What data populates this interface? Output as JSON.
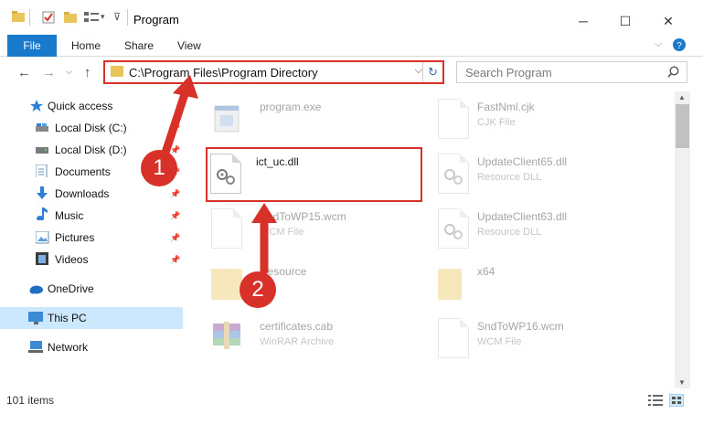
{
  "window": {
    "title": "Program",
    "minimize_glyph": "─",
    "maximize_glyph": "☐",
    "close_glyph": "✕"
  },
  "ribbon": {
    "tabs": [
      "File",
      "Home",
      "Share",
      "View"
    ]
  },
  "address": {
    "path": "C:\\Program Files\\Program Directory",
    "dropdown_glyph": "⌵",
    "refresh_glyph": "↻"
  },
  "search": {
    "placeholder": "Search Program",
    "icon": "search-icon"
  },
  "nav": {
    "items": [
      {
        "label": "Quick access",
        "icon": "star-icon",
        "pinned": false
      },
      {
        "label": "Local Disk (C:)",
        "icon": "drive-icon",
        "pinned": true
      },
      {
        "label": "Local Disk (D:)",
        "icon": "drive-icon",
        "pinned": true
      },
      {
        "label": "Documents",
        "icon": "documents-icon",
        "pinned": true
      },
      {
        "label": "Downloads",
        "icon": "download-icon",
        "pinned": true
      },
      {
        "label": "Music",
        "icon": "music-icon",
        "pinned": true
      },
      {
        "label": "Pictures",
        "icon": "pictures-icon",
        "pinned": true
      },
      {
        "label": "Videos",
        "icon": "videos-icon",
        "pinned": true
      },
      {
        "label": "OneDrive",
        "icon": "cloud-icon",
        "pinned": false
      },
      {
        "label": "This PC",
        "icon": "computer-icon",
        "pinned": false,
        "selected": true
      },
      {
        "label": "Network",
        "icon": "network-icon",
        "pinned": false
      }
    ]
  },
  "files": [
    {
      "name": "program.exe",
      "type": "",
      "icon": "exe-icon"
    },
    {
      "name": "FastNml.cjk",
      "type": "CJK File",
      "icon": "document-icon"
    },
    {
      "name": "ict_uc.dll",
      "type": "",
      "icon": "dll-gear-icon"
    },
    {
      "name": "UpdateClient65.dll",
      "type": "Resource DLL",
      "icon": "dll-gear-icon"
    },
    {
      "name": "SndToWP15.wcm",
      "type": "WCM File",
      "icon": "document-icon"
    },
    {
      "name": "UpdateClient63.dll",
      "type": "Resource DLL",
      "icon": "dll-gear-icon"
    },
    {
      "name": "Resource",
      "type": "",
      "icon": "folder-icon"
    },
    {
      "name": "x64",
      "type": "",
      "icon": "folder-icon"
    },
    {
      "name": "certificates.cab",
      "type": "WinRAR Archive",
      "icon": "archive-icon"
    },
    {
      "name": "SndToWP16.wcm",
      "type": "WCM File",
      "icon": "document-icon"
    }
  ],
  "status": {
    "item_count": "101 items"
  },
  "annotations": {
    "step1": "1",
    "step2": "2",
    "accent_color": "#d8312a"
  },
  "colors": {
    "file_tab": "#1979ca",
    "selection": "#cce8ff",
    "folder": "#e9c45a"
  }
}
